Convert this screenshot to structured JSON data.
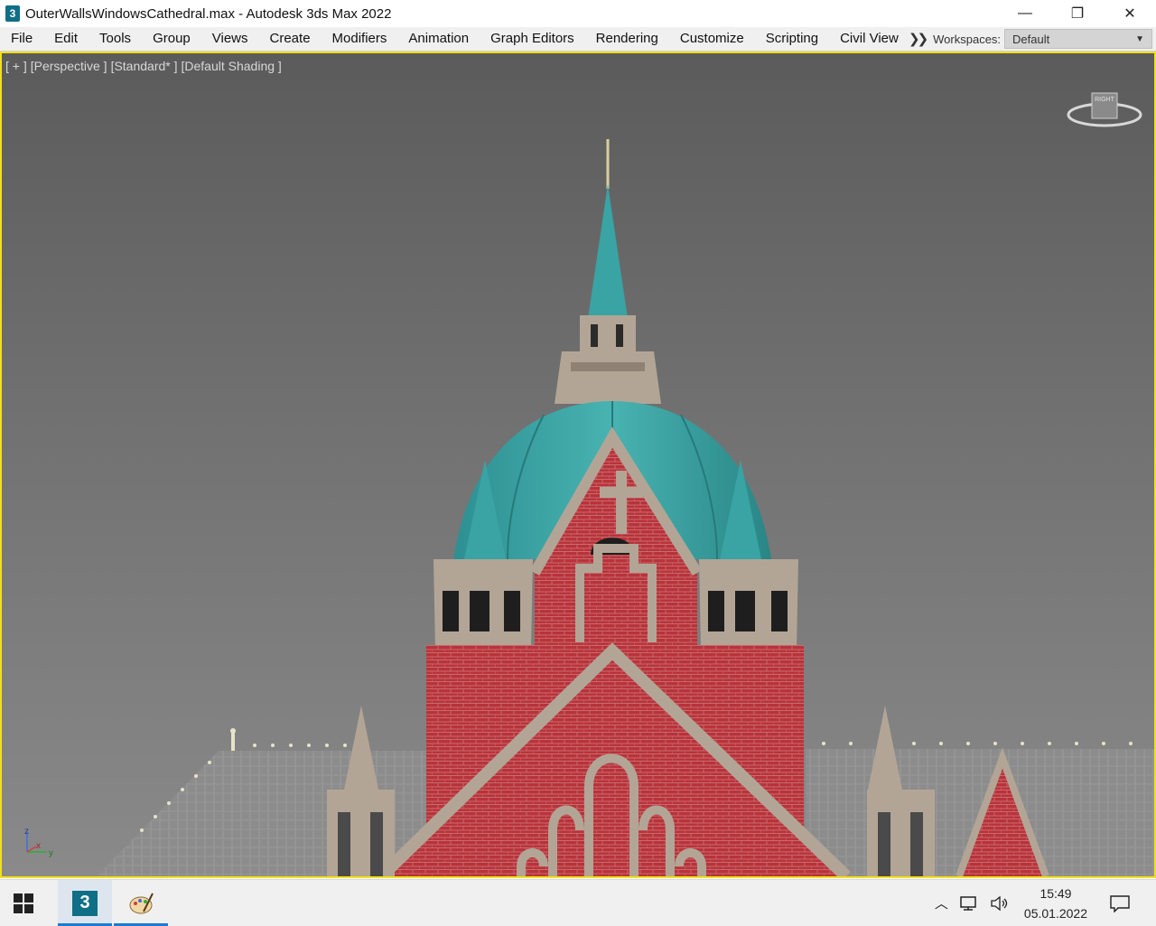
{
  "window": {
    "title": "OuterWallsWindowsCathedral.max - Autodesk 3ds Max 2022",
    "app_icon_label": "3",
    "minimize_glyph": "—",
    "maximize_glyph": "❐",
    "close_glyph": "✕"
  },
  "menubar": {
    "items": [
      "File",
      "Edit",
      "Tools",
      "Group",
      "Views",
      "Create",
      "Modifiers",
      "Animation",
      "Graph Editors",
      "Rendering",
      "Customize",
      "Scripting",
      "Civil View"
    ],
    "workspaces_label": "Workspaces:",
    "workspace_value": "Default"
  },
  "viewport": {
    "labels": [
      "[ + ]",
      "[Perspective ]",
      "[Standard* ]",
      "[Default Shading ]"
    ],
    "viewcube_top_label": "RIGHT",
    "axis": {
      "z": "z",
      "x": "x",
      "y": "y"
    }
  },
  "taskbar": {
    "apps": [
      {
        "name": "3ds-max",
        "label": "3",
        "active": true
      },
      {
        "name": "paint",
        "active": false
      }
    ],
    "clock_time": "15:49",
    "clock_date": "05.01.2022"
  },
  "colors": {
    "viewport_border": "#f2e01a",
    "brick": "#b8333a",
    "copper_roof": "#3aa3a3",
    "stone": "#b3a596"
  }
}
